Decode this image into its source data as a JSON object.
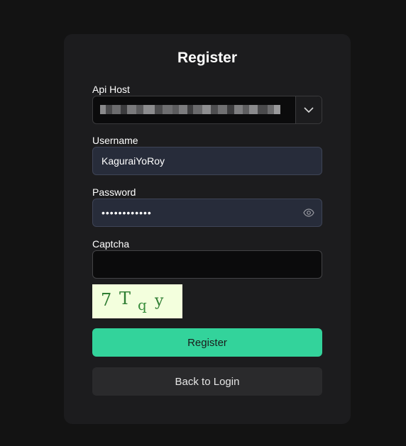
{
  "form": {
    "title": "Register",
    "api_host": {
      "label": "Api Host"
    },
    "username": {
      "label": "Username",
      "value": "KaguraiYoRoy"
    },
    "password": {
      "label": "Password",
      "value": "••••••••••••"
    },
    "captcha": {
      "label": "Captcha",
      "value": "",
      "image_text": "7 T q y"
    },
    "register_button": "Register",
    "back_button": "Back to Login"
  },
  "colors": {
    "background": "#131313",
    "card": "#1c1c1e",
    "primary": "#33d39b",
    "secondary_button": "#2a2a2c",
    "input_filled": "#272c3a",
    "captcha_bg": "#f3ffdd",
    "captcha_text": "#2e7d32"
  },
  "icons": {
    "api_host_dropdown": "chevron-down-icon",
    "password_toggle": "eye-icon"
  }
}
